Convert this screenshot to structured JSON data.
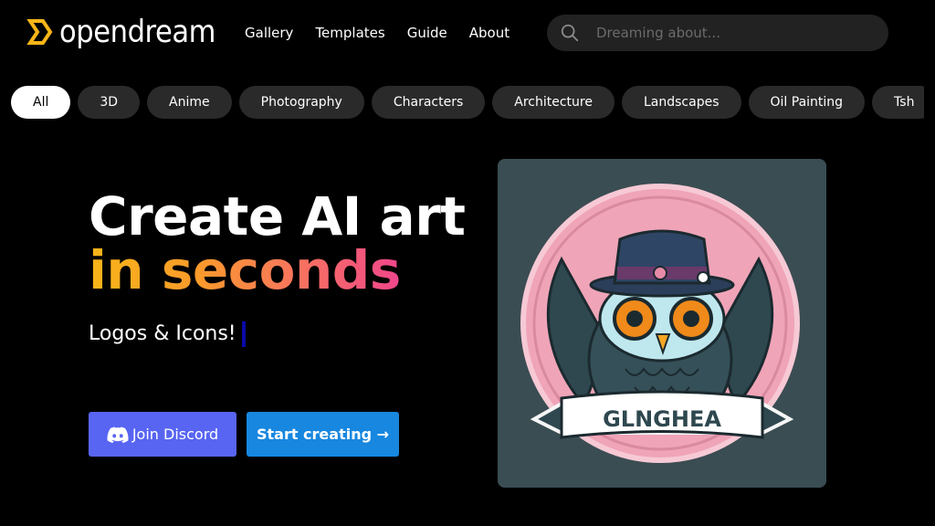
{
  "header": {
    "brand": "opendream",
    "nav": [
      "Gallery",
      "Templates",
      "Guide",
      "About"
    ],
    "search_placeholder": "Dreaming about..."
  },
  "categories": [
    "All",
    "3D",
    "Anime",
    "Photography",
    "Characters",
    "Architecture",
    "Landscapes",
    "Oil Painting",
    "Tsh"
  ],
  "active_category": "All",
  "hero": {
    "title_line1": "Create AI art",
    "title_line2": "in seconds",
    "subtitle": "Logos & Icons!",
    "discord_label": "Join Discord",
    "start_label": "Start creating →",
    "image_text": "GLNGHEA"
  },
  "colors": {
    "background": "#000000",
    "accent_orange": "#f8b518",
    "accent_pink": "#f0468c",
    "discord": "#5865f2",
    "primary": "#1787e0"
  }
}
